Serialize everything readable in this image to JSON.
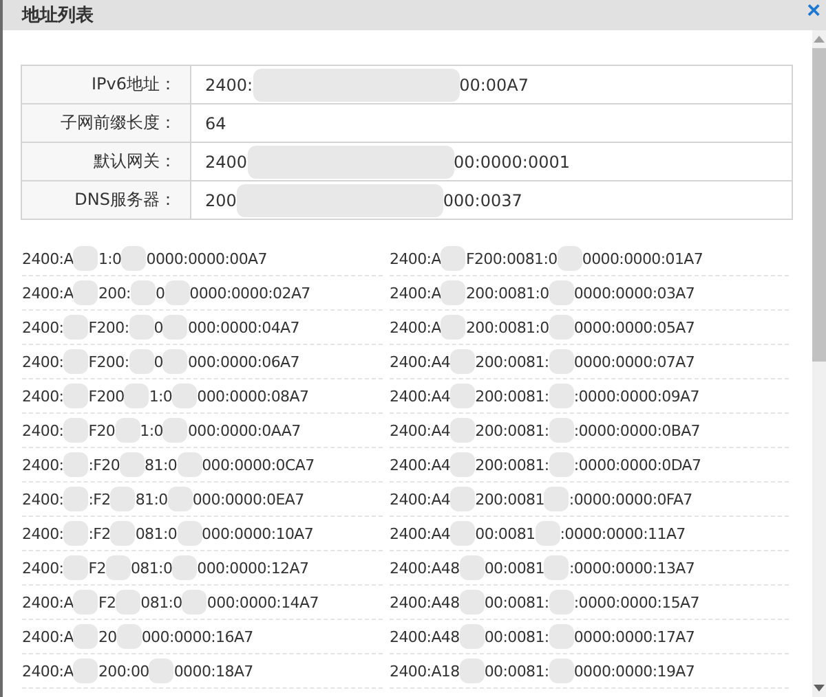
{
  "dialog": {
    "title": "地址列表",
    "close_icon": "×"
  },
  "details": [
    {
      "label": "IPv6地址：",
      "value_parts": [
        "2400:",
        "00:00A7"
      ]
    },
    {
      "label": "子网前缀长度：",
      "value_parts": [
        "64"
      ]
    },
    {
      "label": "默认网关：",
      "value_parts": [
        "2400",
        "00:0000:0001"
      ]
    },
    {
      "label": "DNS服务器：",
      "value_parts": [
        "200",
        "000:0037"
      ]
    }
  ],
  "addresses": [
    [
      [
        "2400:A",
        "1:0",
        "0000:0000:00A7"
      ],
      [
        "2400:A",
        "F200:0081:0",
        "0000:0000:01A7"
      ]
    ],
    [
      [
        "2400:A",
        "200:",
        "0",
        "0000:0000:02A7"
      ],
      [
        "2400:A",
        "200:0081:0",
        "0000:0000:03A7"
      ]
    ],
    [
      [
        "2400:",
        "F200:",
        "0",
        "000:0000:04A7"
      ],
      [
        "2400:A",
        "200:0081:0",
        "0000:0000:05A7"
      ]
    ],
    [
      [
        "2400:",
        "F200:",
        "0",
        "000:0000:06A7"
      ],
      [
        "2400:A4",
        "200:0081:",
        "0000:0000:07A7"
      ]
    ],
    [
      [
        "2400:",
        "F200",
        "1:0",
        "000:0000:08A7"
      ],
      [
        "2400:A4",
        "200:0081:",
        ":0000:0000:09A7"
      ]
    ],
    [
      [
        "2400:",
        "F20",
        "1:0",
        "000:0000:0AA7"
      ],
      [
        "2400:A4",
        "200:0081:",
        ":0000:0000:0BA7"
      ]
    ],
    [
      [
        "2400:",
        ":F20",
        "81:0",
        "000:0000:0CA7"
      ],
      [
        "2400:A4",
        "200:0081:",
        ":0000:0000:0DA7"
      ]
    ],
    [
      [
        "2400:",
        ":F2",
        "81:0",
        "000:0000:0EA7"
      ],
      [
        "2400:A4",
        "200:0081",
        ":0000:0000:0FA7"
      ]
    ],
    [
      [
        "2400:",
        ":F2",
        "081:0",
        "000:0000:10A7"
      ],
      [
        "2400:A4",
        "00:0081",
        ":0000:0000:11A7"
      ]
    ],
    [
      [
        "2400:",
        "F2",
        "081:0",
        "000:0000:12A7"
      ],
      [
        "2400:A48",
        "00:0081",
        ":0000:0000:13A7"
      ]
    ],
    [
      [
        "2400:A",
        "F2",
        "081:0",
        "000:0000:14A7"
      ],
      [
        "2400:A48",
        "00:0081:",
        ":0000:0000:15A7"
      ]
    ],
    [
      [
        "2400:A",
        "20",
        "000:0000:16A7"
      ],
      [
        "2400:A48",
        "00:0081:",
        "0000:0000:17A7"
      ]
    ],
    [
      [
        "2400:A",
        "200:00",
        "0000:18A7"
      ],
      [
        "2400:A18",
        "00:0081:",
        "0000:0000:19A7"
      ]
    ]
  ]
}
